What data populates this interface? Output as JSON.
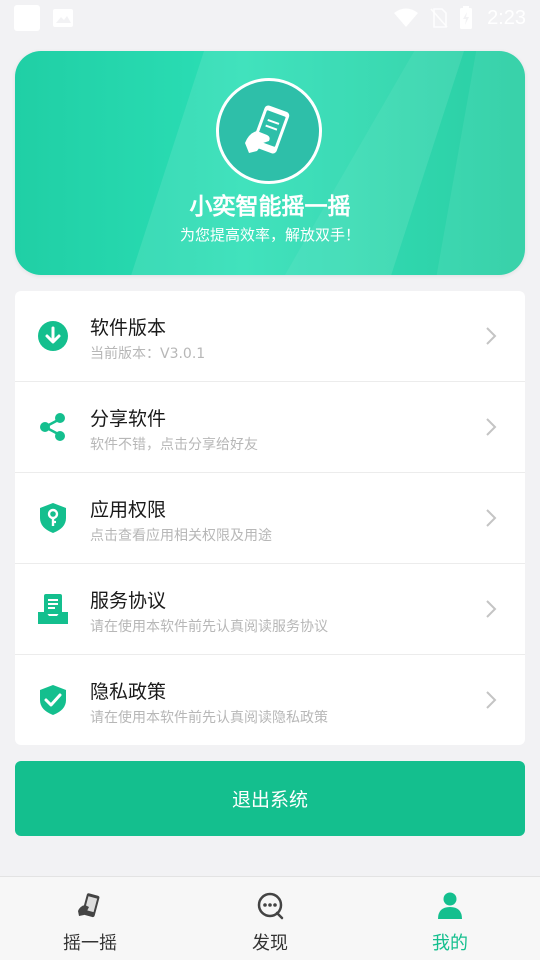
{
  "status_bar": {
    "time": "2:23"
  },
  "hero": {
    "title": "小奕智能摇一摇",
    "subtitle": "为您提高效率，解放双手！"
  },
  "menu": {
    "items": [
      {
        "title": "软件版本",
        "subtitle": "当前版本：V3.0.1",
        "icon": "download-icon"
      },
      {
        "title": "分享软件",
        "subtitle": "软件不错，点击分享给好友",
        "icon": "share-icon"
      },
      {
        "title": "应用权限",
        "subtitle": "点击查看应用相关权限及用途",
        "icon": "shield-key-icon"
      },
      {
        "title": "服务协议",
        "subtitle": "请在使用本软件前先认真阅读服务协议",
        "icon": "document-tray-icon"
      },
      {
        "title": "隐私政策",
        "subtitle": "请在使用本软件前先认真阅读隐私政策",
        "icon": "shield-check-icon"
      }
    ]
  },
  "logout_label": "退出系统",
  "tabs": [
    {
      "label": "摇一摇",
      "icon": "shake-phone-icon",
      "active": false
    },
    {
      "label": "发现",
      "icon": "discover-chat-icon",
      "active": false
    },
    {
      "label": "我的",
      "icon": "person-icon",
      "active": true
    }
  ],
  "colors": {
    "accent": "#14bf8e",
    "hero_gradient_start": "#20cfa5",
    "hero_gradient_end": "#1dcc9e",
    "subtitle_gray": "#b7b7b7"
  }
}
